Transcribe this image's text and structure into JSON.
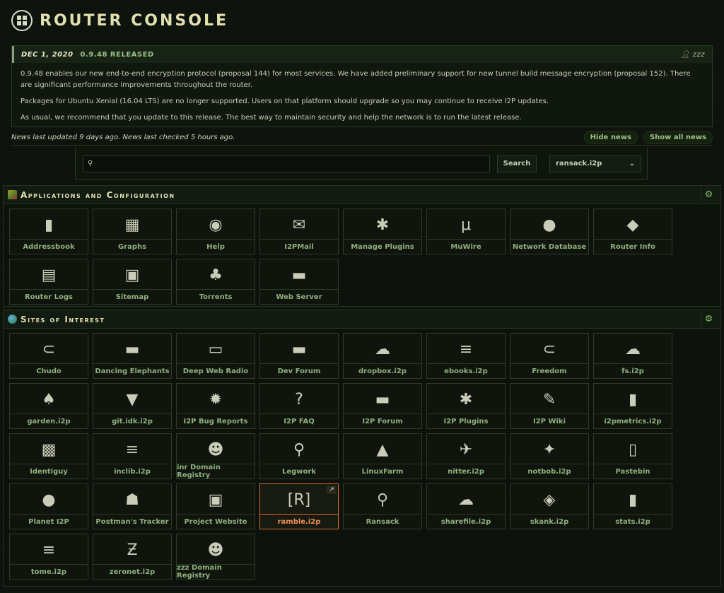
{
  "header": {
    "title": "ROUTER CONSOLE",
    "logo_icon": "i2p-logo-icon"
  },
  "news": {
    "date": "DEC 1, 2020",
    "version_title": "0.9.48 RELEASED",
    "author": "zzz",
    "paragraphs": [
      "0.9.48 enables our new end-to-end encryption protocol (proposal 144) for most services. We have added preliminary support for new tunnel build message encryption (proposal 152). There are significant performance improvements throughout the router.",
      "Packages for Ubuntu Xenial (16.04 LTS) are no longer supported. Users on that platform should upgrade so you may continue to receive I2P updates.",
      "As usual, we recommend that you update to this release. The best way to maintain security and help the network is to run the latest release."
    ],
    "status": "News last updated 9 days ago. News last checked 5 hours ago.",
    "hide_label": "Hide news",
    "show_all_label": "Show all news"
  },
  "search": {
    "value": "",
    "button_label": "Search",
    "engine": "ransack.i2p"
  },
  "apps": {
    "title": "Applications and Configuration",
    "items": [
      {
        "label": "Addressbook",
        "icon": "addressbook-icon",
        "glyph": "▮"
      },
      {
        "label": "Graphs",
        "icon": "graphs-icon",
        "glyph": "▦"
      },
      {
        "label": "Help",
        "icon": "help-icon",
        "glyph": "◉"
      },
      {
        "label": "I2PMail",
        "icon": "mail-icon",
        "glyph": "✉"
      },
      {
        "label": "Manage Plugins",
        "icon": "plugins-icon",
        "glyph": "✱"
      },
      {
        "label": "MuWire",
        "icon": "muwire-icon",
        "glyph": "μ"
      },
      {
        "label": "Network Database",
        "icon": "globe-icon",
        "glyph": "●"
      },
      {
        "label": "Router Info",
        "icon": "info-icon",
        "glyph": "◆"
      },
      {
        "label": "Router Logs",
        "icon": "logs-icon",
        "glyph": "▤"
      },
      {
        "label": "Sitemap",
        "icon": "sitemap-icon",
        "glyph": "▣"
      },
      {
        "label": "Torrents",
        "icon": "torrents-icon",
        "glyph": "♣"
      },
      {
        "label": "Web Server",
        "icon": "server-icon",
        "glyph": "▬"
      }
    ]
  },
  "sites": {
    "title": "Sites of Interest",
    "items": [
      {
        "label": "Chudo",
        "icon": "magnet-icon",
        "glyph": "⊂"
      },
      {
        "label": "Dancing Elephants",
        "icon": "forum-icon",
        "glyph": "▬"
      },
      {
        "label": "Deep Web Radio",
        "icon": "radio-icon",
        "glyph": "▭"
      },
      {
        "label": "Dev Forum",
        "icon": "forum-icon",
        "glyph": "▬"
      },
      {
        "label": "dropbox.i2p",
        "icon": "cloud-upload-icon",
        "glyph": "☁"
      },
      {
        "label": "ebooks.i2p",
        "icon": "books-icon",
        "glyph": "≡"
      },
      {
        "label": "Freedom",
        "icon": "magnet-icon",
        "glyph": "⊂"
      },
      {
        "label": "fs.i2p",
        "icon": "cloud-upload-icon",
        "glyph": "☁"
      },
      {
        "label": "garden.i2p",
        "icon": "plant-icon",
        "glyph": "♠"
      },
      {
        "label": "git.idk.i2p",
        "icon": "gitlab-icon",
        "glyph": "▼"
      },
      {
        "label": "I2P Bug Reports",
        "icon": "bug-icon",
        "glyph": "✹"
      },
      {
        "label": "I2P FAQ",
        "icon": "faq-icon",
        "glyph": "?"
      },
      {
        "label": "I2P Forum",
        "icon": "forum-icon",
        "glyph": "▬"
      },
      {
        "label": "I2P Plugins",
        "icon": "plugins-icon",
        "glyph": "✱"
      },
      {
        "label": "I2P Wiki",
        "icon": "pen-icon",
        "glyph": "✎"
      },
      {
        "label": "i2pmetrics.i2p",
        "icon": "bars-icon",
        "glyph": "▮"
      },
      {
        "label": "Identiguy",
        "icon": "gauge-icon",
        "glyph": "▩"
      },
      {
        "label": "inclib.i2p",
        "icon": "books-icon",
        "glyph": "≡"
      },
      {
        "label": "inr Domain Registry",
        "icon": "agent-icon",
        "glyph": "☻"
      },
      {
        "label": "Legwork",
        "icon": "magnifier-icon",
        "glyph": "⚲"
      },
      {
        "label": "LinuxFarm",
        "icon": "penguin-icon",
        "glyph": "▲"
      },
      {
        "label": "nitter.i2p",
        "icon": "bird-icon",
        "glyph": "✈"
      },
      {
        "label": "notbob.i2p",
        "icon": "star-circle-icon",
        "glyph": "✦"
      },
      {
        "label": "Pastebin",
        "icon": "clipboard-icon",
        "glyph": "▯"
      },
      {
        "label": "Planet I2P",
        "icon": "globe-icon",
        "glyph": "●"
      },
      {
        "label": "Postman's Tracker",
        "icon": "postman-icon",
        "glyph": "☗"
      },
      {
        "label": "Project Website",
        "icon": "i2p-website-icon",
        "glyph": "▣"
      },
      {
        "label": "ramble.i2p",
        "icon": "ramble-icon",
        "glyph": "[R]"
      },
      {
        "label": "Ransack",
        "icon": "magnifier-icon",
        "glyph": "⚲"
      },
      {
        "label": "sharefile.i2p",
        "icon": "cloud-upload-icon",
        "glyph": "☁"
      },
      {
        "label": "skank.i2p",
        "icon": "cube-icon",
        "glyph": "◈"
      },
      {
        "label": "stats.i2p",
        "icon": "bars-icon",
        "glyph": "▮"
      },
      {
        "label": "tome.i2p",
        "icon": "books-icon",
        "glyph": "≡"
      },
      {
        "label": "zeronet.i2p",
        "icon": "zeronet-icon",
        "glyph": "Ƶ"
      },
      {
        "label": "zzz Domain Registry",
        "icon": "agent-icon",
        "glyph": "☻"
      }
    ],
    "active": "ramble.i2p"
  },
  "colors": {
    "accent": "#8fb07e",
    "title": "#e2e0b0",
    "active": "#d86a30",
    "background": "#0d130c"
  }
}
